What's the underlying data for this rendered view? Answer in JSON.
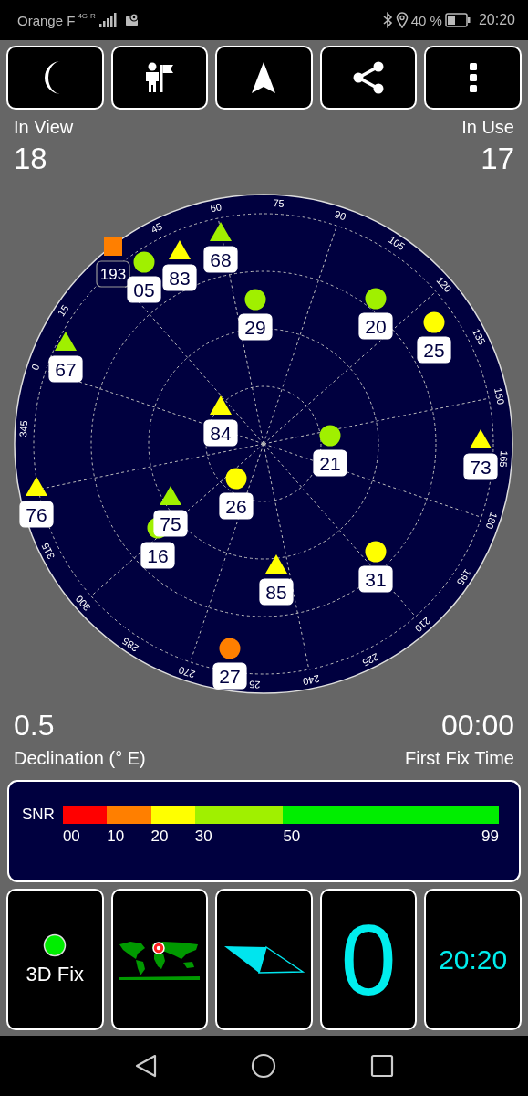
{
  "status_bar": {
    "carrier": "Orange F",
    "network": "4G",
    "roaming": "R",
    "battery": "40 %",
    "time": "20:20"
  },
  "in_view": {
    "label": "In View",
    "value": "18"
  },
  "in_use": {
    "label": "In Use",
    "value": "17"
  },
  "skyplot": {
    "azimuth_labels": [
      "0",
      "15",
      "45",
      "60",
      "75",
      "90",
      "105",
      "120",
      "135",
      "150",
      "165",
      "180",
      "195",
      "210",
      "225",
      "240",
      "25",
      "270",
      "285",
      "300",
      "315",
      "345"
    ],
    "satellites": [
      {
        "label": "193",
        "kind": "square",
        "color": "#ff7f00",
        "in_use": false
      },
      {
        "label": "05",
        "kind": "circle",
        "color": "#a0f000",
        "in_use": true
      },
      {
        "label": "83",
        "kind": "triangle",
        "color": "#ffff00",
        "in_use": true
      },
      {
        "label": "68",
        "kind": "triangle",
        "color": "#a0f000",
        "in_use": true
      },
      {
        "label": "29",
        "kind": "circle",
        "color": "#a0f000",
        "in_use": true
      },
      {
        "label": "20",
        "kind": "circle",
        "color": "#a0f000",
        "in_use": true
      },
      {
        "label": "25",
        "kind": "circle",
        "color": "#ffff00",
        "in_use": true
      },
      {
        "label": "67",
        "kind": "triangle",
        "color": "#a0f000",
        "in_use": true
      },
      {
        "label": "84",
        "kind": "triangle",
        "color": "#ffff00",
        "in_use": true
      },
      {
        "label": "21",
        "kind": "circle",
        "color": "#a0f000",
        "in_use": true
      },
      {
        "label": "73",
        "kind": "triangle",
        "color": "#ffff00",
        "in_use": true
      },
      {
        "label": "76",
        "kind": "triangle",
        "color": "#ffff00",
        "in_use": true
      },
      {
        "label": "75",
        "kind": "triangle",
        "color": "#a0f000",
        "in_use": true
      },
      {
        "label": "16",
        "kind": "circle",
        "color": "#a0f000",
        "in_use": true
      },
      {
        "label": "26",
        "kind": "circle",
        "color": "#ffff00",
        "in_use": true
      },
      {
        "label": "85",
        "kind": "triangle",
        "color": "#ffff00",
        "in_use": true
      },
      {
        "label": "31",
        "kind": "circle",
        "color": "#ffff00",
        "in_use": true
      },
      {
        "label": "27",
        "kind": "circle",
        "color": "#ff7f00",
        "in_use": true
      }
    ]
  },
  "declination": {
    "value": "0.5",
    "label": "Declination (° E)"
  },
  "first_fix": {
    "value": "00:00",
    "label": "First Fix Time"
  },
  "snr": {
    "label": "SNR",
    "segments": [
      {
        "color": "#ff0000"
      },
      {
        "color": "#ff7f00"
      },
      {
        "color": "#ffff00"
      },
      {
        "color": "#a0f000"
      },
      {
        "color": "#00ee00"
      }
    ],
    "ticks": [
      "00",
      "10",
      "20",
      "30",
      "50",
      "99"
    ]
  },
  "tiles": [
    {
      "kind": "fix",
      "label": "3D Fix",
      "color": "#00ee00"
    },
    {
      "kind": "map"
    },
    {
      "kind": "compass"
    },
    {
      "kind": "speed",
      "value": "0"
    },
    {
      "kind": "clock",
      "value": "20:20"
    }
  ]
}
